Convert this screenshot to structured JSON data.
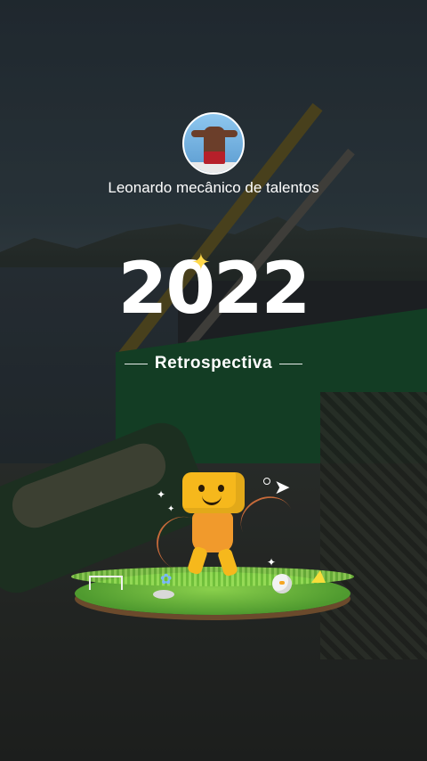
{
  "profile": {
    "name": "Leonardo mecânico de talentos"
  },
  "hero": {
    "year": "2022",
    "subtitle": "Retrospectiva"
  },
  "icons": {
    "sparkle": "sparkle-icon",
    "plane": "paper-plane-icon",
    "mascot": "mascot-character",
    "flower": "flower-icon",
    "chick": "chick-icon",
    "fence": "fence-icon",
    "cheese": "cheese-icon"
  },
  "colors": {
    "text": "#ffffff",
    "accent_yellow": "#ffd84a",
    "mascot_orange": "#f6b81c",
    "grass": "#6fbf3a"
  }
}
